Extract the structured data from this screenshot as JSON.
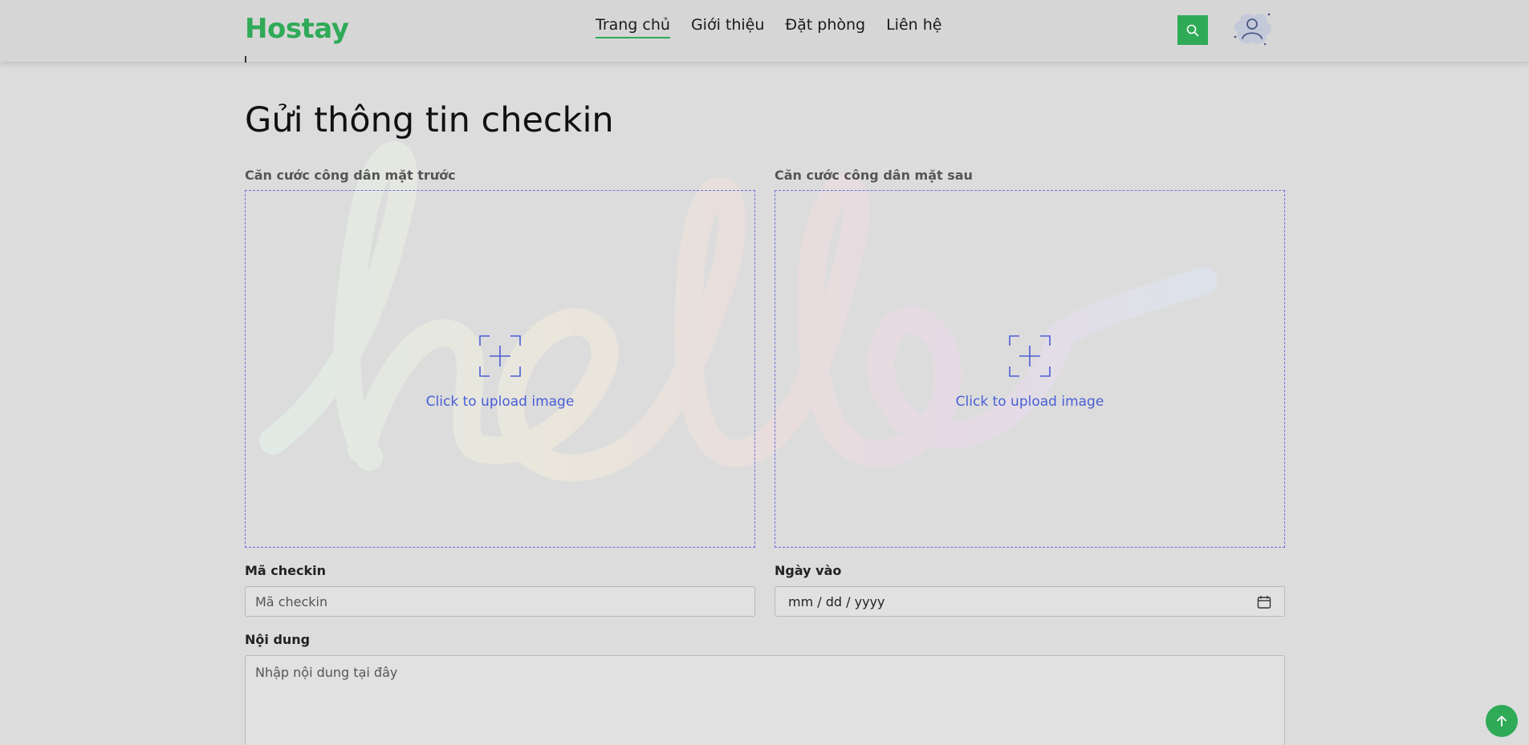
{
  "brand": {
    "logo": "Hostay",
    "accent": "#2faa57"
  },
  "nav": {
    "items": [
      {
        "label": "Trang chủ",
        "active": true
      },
      {
        "label": "Giới thiệu"
      },
      {
        "label": "Đặt phòng"
      },
      {
        "label": "Liên hệ"
      }
    ]
  },
  "header": {
    "search_icon": "search-icon",
    "avatar_icon": "user-avatar-icon"
  },
  "page": {
    "title": "Gửi thông tin checkin"
  },
  "upload": {
    "front_label": "Căn cước công dân mặt trước",
    "back_label": "Căn cước công dân mặt sau",
    "cta": "Click to upload image",
    "icon": "add-image-icon"
  },
  "form": {
    "checkin_label": "Mã checkin",
    "checkin_placeholder": "Mã checkin",
    "date_label": "Ngày vào",
    "date_placeholder": "mm / dd / yyyy",
    "content_label": "Nội dung",
    "content_placeholder": "Nhập nội dung tại đây"
  },
  "back_to_top_icon": "arrow-up-icon"
}
